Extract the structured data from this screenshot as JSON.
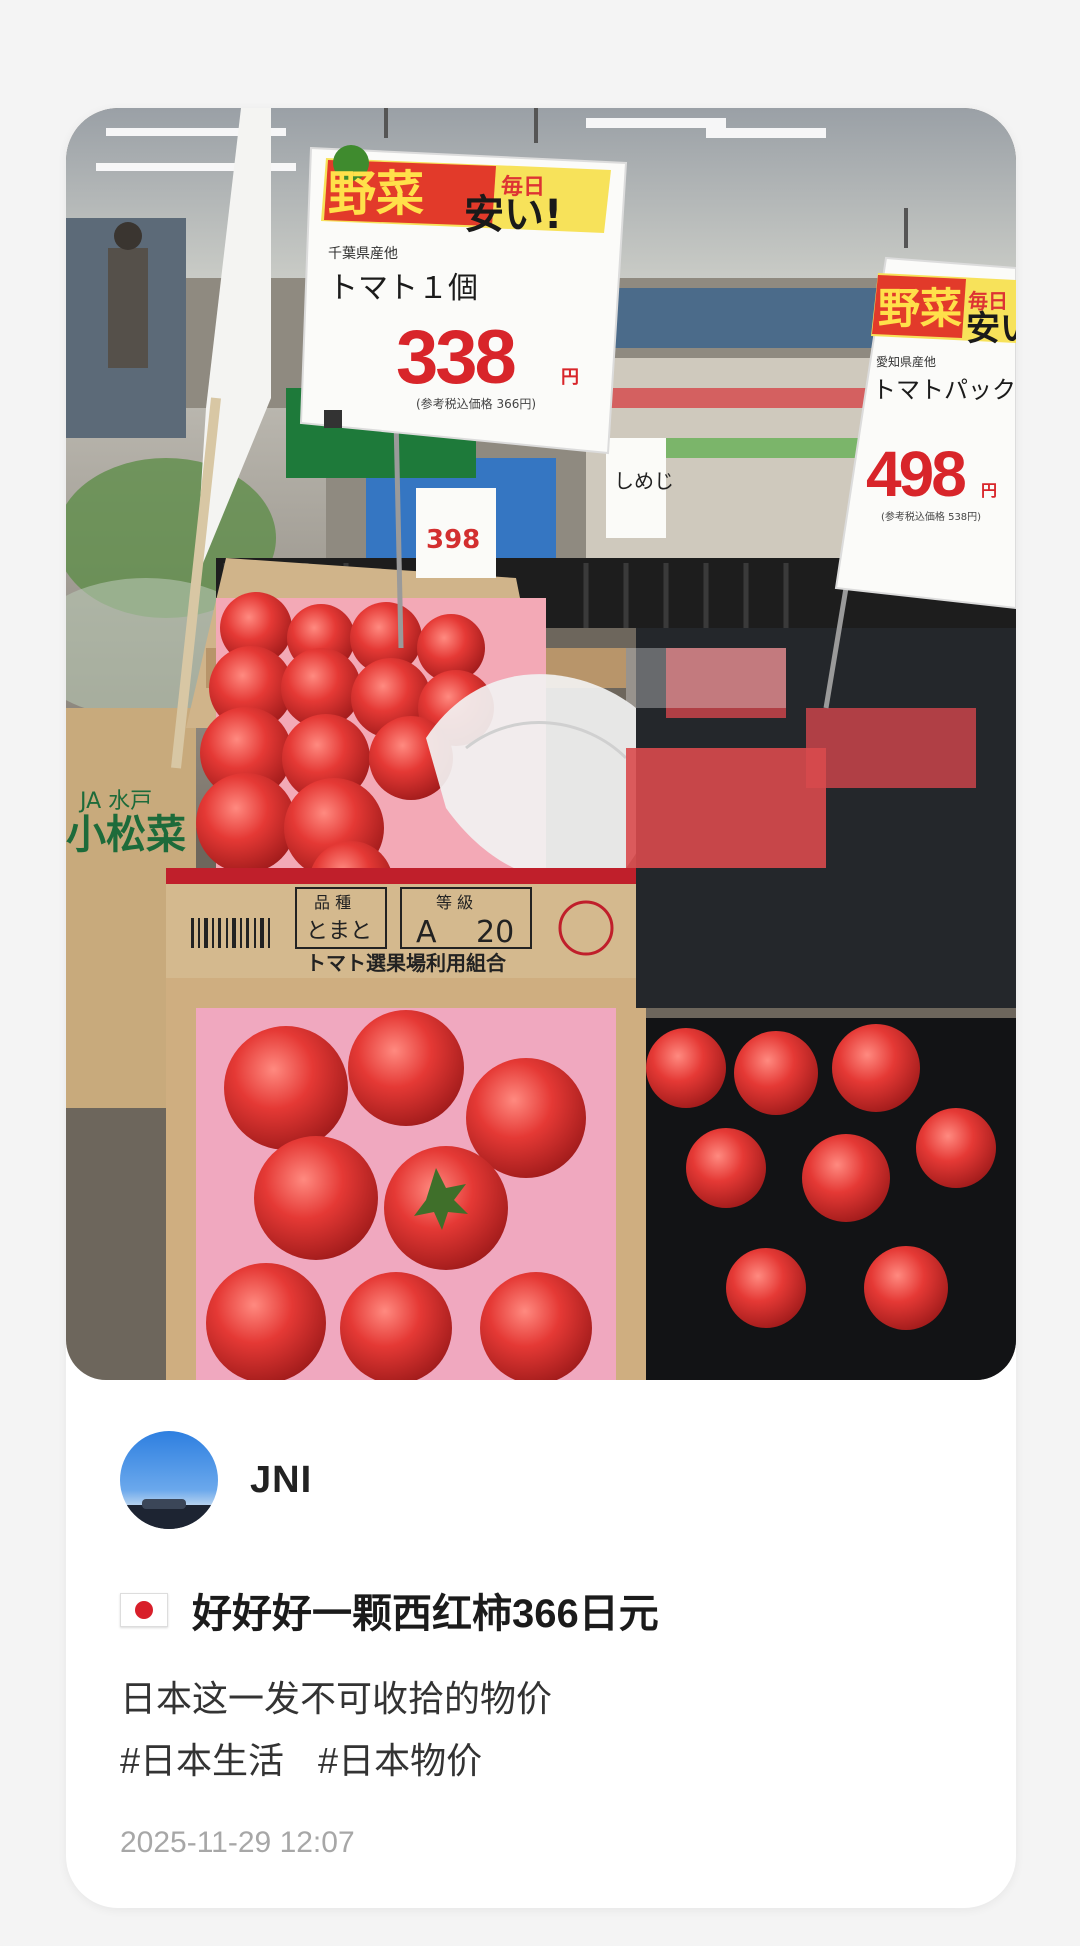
{
  "post": {
    "photo": {
      "signs": {
        "banner_mainichi": "毎日",
        "banner_yasai": "野菜",
        "banner_yasui": "安い!",
        "left_origin": "千葉県産他",
        "left_name": "トマト１個",
        "left_price": "338",
        "left_yen": "円",
        "left_tax_note": "(参考税込価格 366円)",
        "right_origin": "愛知県産他",
        "right_name": "トマトパック",
        "right_price": "498",
        "right_yen": "円",
        "right_tax_note": "(参考税込価格 538円)",
        "small_price": "398",
        "shimeji": "しめじ",
        "box_variety_label": "品 種",
        "box_variety": "とまと",
        "box_grade_label": "等 級",
        "box_grade": "A",
        "box_count": "20",
        "box_org": "トマト選果場利用組合",
        "box_side_ja": "JA 水戸",
        "box_side_name": "小松菜"
      }
    },
    "author": {
      "name": "JNI"
    },
    "flag_icon": "japan-flag-icon",
    "title": "好好好一颗西红柿366日元",
    "description": "日本这一发不可收拾的物价",
    "tags": [
      "#日本生活",
      "#日本物价"
    ],
    "timestamp": "2025-11-29 12:07"
  }
}
